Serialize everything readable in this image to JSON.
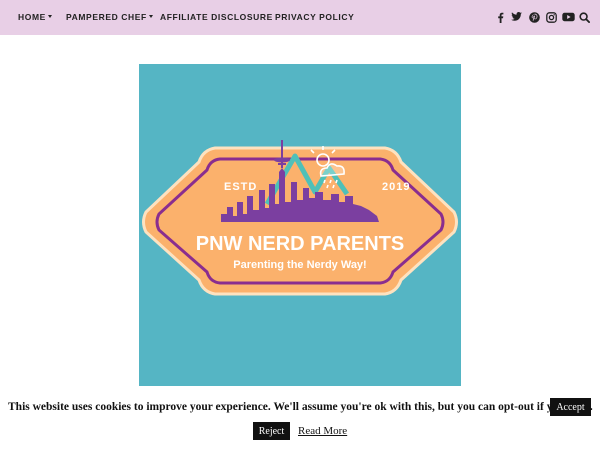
{
  "nav": {
    "items": [
      {
        "label": "HOME",
        "has_dropdown": true
      },
      {
        "label": "PAMPERED CHEF",
        "has_dropdown": true
      },
      {
        "label": "AFFILIATE DISCLOSURE",
        "has_dropdown": false
      },
      {
        "label": "PRIVACY POLICY",
        "has_dropdown": false
      }
    ],
    "social_icons": [
      "facebook-icon",
      "twitter-icon",
      "pinterest-icon",
      "instagram-icon",
      "youtube-icon",
      "search-icon"
    ],
    "background_color": "#e8cfe6"
  },
  "feature_logo": {
    "estd_label": "ESTD",
    "year": "2019",
    "title": "PNW NERD PARENTS",
    "tagline": "Parenting the Nerdy Way!",
    "colors": {
      "background": "#55b5c4",
      "badge_fill": "#fbb16c",
      "badge_border": "#8a2d8f",
      "skyline": "#7b3fa0",
      "mountain": "#4fc0b8"
    }
  },
  "cookie_bar": {
    "message": "This website uses cookies to improve your experience. We'll assume you're ok with this, but you can opt-out if you wish.",
    "accept_label": "Accept",
    "reject_label": "Reject",
    "read_more_label": "Read More"
  }
}
